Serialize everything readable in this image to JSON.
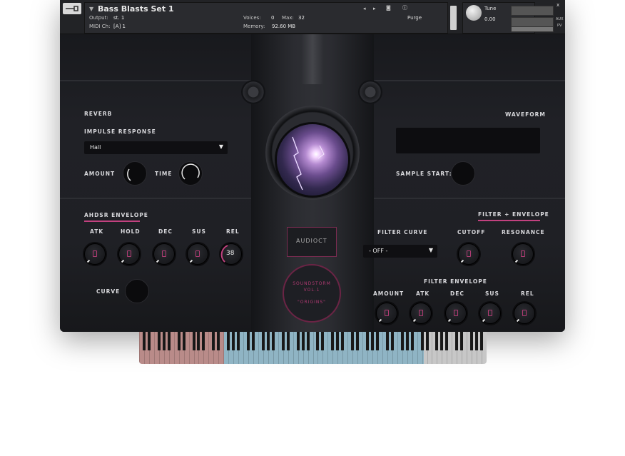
{
  "header": {
    "title": "Bass Blasts Set 1",
    "output_label": "Output:",
    "output_value": "st. 1",
    "voices_label": "Voices:",
    "voices_value": "0",
    "max_label": "Max:",
    "max_value": "32",
    "midi_label": "MIDI Ch:",
    "midi_value": "[A] 1",
    "memory_label": "Memory:",
    "memory_value": "92.60 MB",
    "purge_label": "Purge",
    "tune_label": "Tune",
    "tune_value": "0.00",
    "aux_label": "AUX",
    "pv_label": "PV",
    "close_label": "x"
  },
  "reverb": {
    "section_label": "REVERB",
    "impulse_label": "IMPULSE RESPONSE",
    "impulse_value": "Hall",
    "amount_label": "AMOUNT",
    "time_label": "TIME"
  },
  "waveform": {
    "section_label": "WAVEFORM",
    "sample_start_label": "SAMPLE START:"
  },
  "ahdsr": {
    "section_label": "AHDSR ENVELOPE",
    "knobs": [
      {
        "label": "ATK"
      },
      {
        "label": "HOLD"
      },
      {
        "label": "DEC"
      },
      {
        "label": "SUS"
      },
      {
        "label": "REL",
        "value": "38"
      }
    ],
    "curve_label": "CURVE"
  },
  "filter": {
    "section_label": "FILTER + ENVELOPE",
    "curve_label": "FILTER CURVE",
    "curve_value": "- OFF -",
    "cutoff_label": "CUTOFF",
    "resonance_label": "RESONANCE",
    "envelope_label": "FILTER ENVELOPE",
    "env_knobs": [
      {
        "label": "AMOUNT"
      },
      {
        "label": "ATK"
      },
      {
        "label": "DEC"
      },
      {
        "label": "SUS"
      },
      {
        "label": "REL"
      }
    ]
  },
  "center": {
    "logo_text": "AUDIOCT",
    "soundstorm_line1": "SOUNDSTORM",
    "soundstorm_line2": "VOL.1",
    "soundstorm_line3": "\"ORIGINS\""
  },
  "colors": {
    "accent": "#c2417f",
    "background": "#1d1e22",
    "keyboard_red": "#b98b89",
    "keyboard_blue": "#8fb4c4",
    "keyboard_grey": "#c7c7c7"
  }
}
